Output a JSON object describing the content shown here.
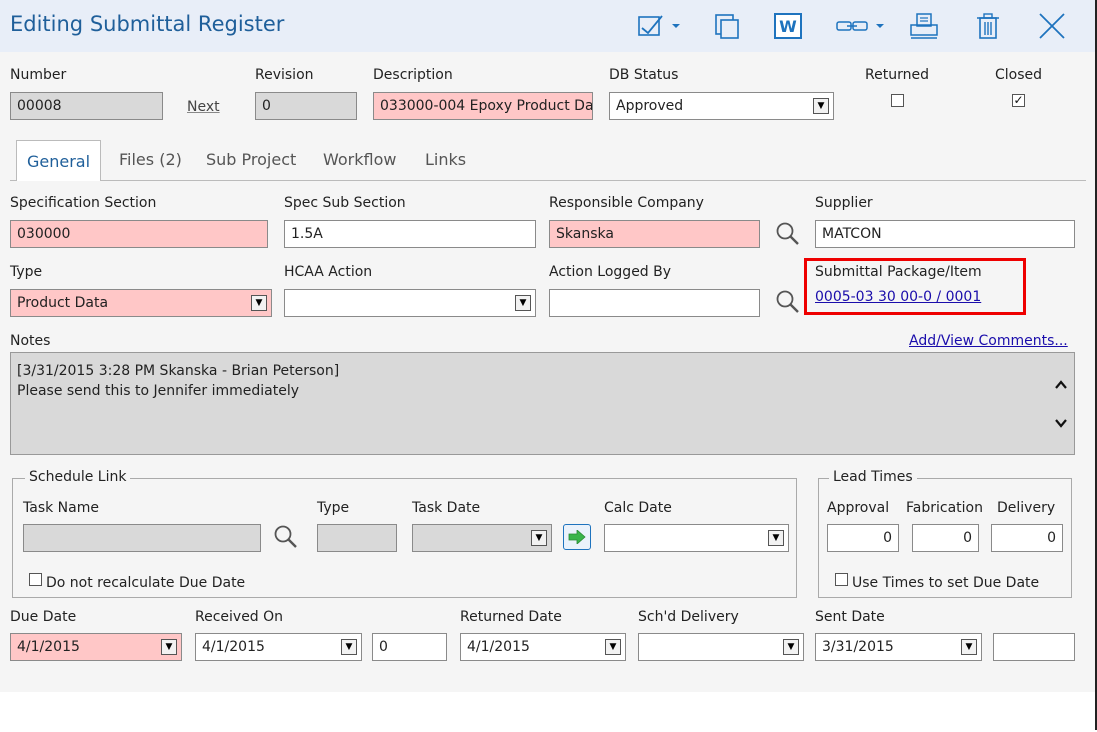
{
  "header": {
    "title": "Editing Submittal Register",
    "toolbar": {
      "w_label": "W"
    }
  },
  "top": {
    "number_label": "Number",
    "number_value": "00008",
    "next_label": "Next",
    "revision_label": "Revision",
    "revision_value": "0",
    "description_label": "Description",
    "description_value": "033000-004 Epoxy Product Data",
    "db_status_label": "DB Status",
    "db_status_value": "Approved",
    "returned_label": "Returned",
    "returned_checked": false,
    "closed_label": "Closed",
    "closed_checked": true
  },
  "tabs": [
    {
      "label": "General"
    },
    {
      "label": "Files (2)"
    },
    {
      "label": "Sub Project"
    },
    {
      "label": "Workflow"
    },
    {
      "label": "Links"
    }
  ],
  "general": {
    "spec_section_label": "Specification Section",
    "spec_section_value": "030000",
    "spec_sub_label": "Spec Sub Section",
    "spec_sub_value": "1.5A",
    "resp_company_label": "Responsible Company",
    "resp_company_value": "Skanska",
    "supplier_label": "Supplier",
    "supplier_value": "MATCON",
    "type_label": "Type",
    "type_value": "Product Data",
    "hcaa_label": "HCAA Action",
    "hcaa_value": "",
    "logged_by_label": "Action Logged By",
    "logged_by_value": "",
    "package_label": "Submittal Package/Item",
    "package_link": "0005-03 30 00-0 / 0001",
    "notes_label": "Notes",
    "add_view_comments": "Add/View Comments...",
    "notes_line1": "[3/31/2015 3:28 PM Skanska - Brian Peterson]",
    "notes_line2": "Please send this to Jennifer immediately"
  },
  "schedule": {
    "legend": "Schedule Link",
    "task_name_label": "Task Name",
    "task_name_value": "",
    "type_label": "Type",
    "type_value": "",
    "task_date_label": "Task Date",
    "task_date_value": "",
    "calc_date_label": "Calc Date",
    "calc_date_value": "",
    "no_recalc_label": "Do not recalculate Due Date"
  },
  "lead_times": {
    "legend": "Lead Times",
    "approval_label": "Approval",
    "approval_value": "0",
    "fabrication_label": "Fabrication",
    "fabrication_value": "0",
    "delivery_label": "Delivery",
    "delivery_value": "0",
    "use_times_label": "Use Times to set Due Date"
  },
  "dates": {
    "due_label": "Due Date",
    "due_value": "4/1/2015",
    "received_label": "Received On",
    "received_value": "4/1/2015",
    "received_days": "0",
    "returned_label": "Returned Date",
    "returned_value": "4/1/2015",
    "schd_delivery_label": "Sch'd Delivery",
    "schd_delivery_value": "",
    "sent_label": "Sent Date",
    "sent_value": "3/31/2015",
    "sent_extra": ""
  },
  "colors": {
    "accent": "#1e73be",
    "required_bg": "#ffc7c7",
    "highlight_border": "#e00000"
  }
}
